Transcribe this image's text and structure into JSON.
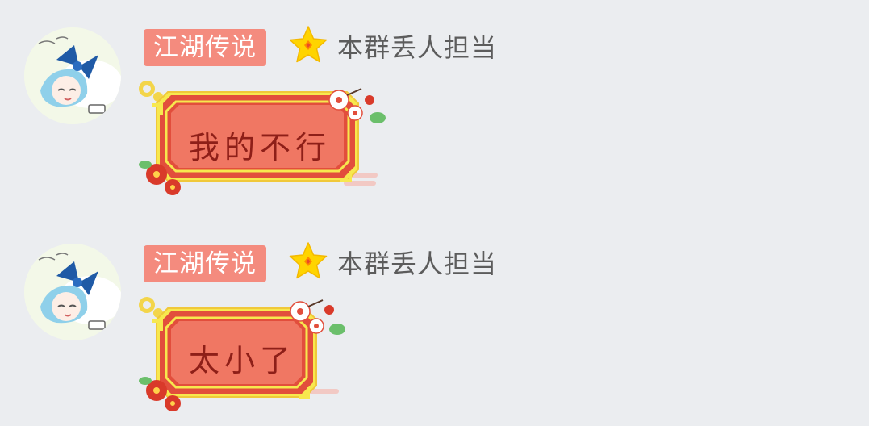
{
  "messages": [
    {
      "tag": "江湖传说",
      "nickname": "本群丢人担当",
      "sticker_text": "我的不行"
    },
    {
      "tag": "江湖传说",
      "nickname": "本群丢人担当",
      "sticker_text": "太小了"
    }
  ],
  "colors": {
    "background": "#ebedf0",
    "tag_bg": "#f48b7e",
    "star": "#ffd400",
    "frame_gold": "#f6e34a",
    "frame_red": "#ee5a4a"
  }
}
